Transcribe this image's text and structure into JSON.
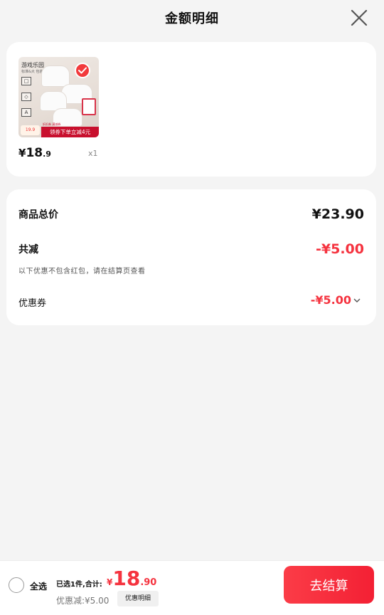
{
  "header": {
    "title": "金额明细",
    "close_icon": "close-icon"
  },
  "product": {
    "image_title": "游戏乐园",
    "image_subtitle": "标准&大 包装",
    "image_icons": [
      "□",
      "◇",
      "A"
    ],
    "image_price_tag": "19.9",
    "image_promo_top": "折扣券 满减券",
    "image_promo": "领券下单立减4元",
    "selected": true,
    "price_symbol": "¥",
    "price_int": "18",
    "price_dec": ".9",
    "qty": "x1"
  },
  "summary": {
    "total_label": "商品总价",
    "total_value": "¥23.90",
    "discount_label": "共减",
    "discount_value": "-¥5.00",
    "note": "以下优惠不包含红包，请在结算页查看",
    "coupon_label": "优惠券",
    "coupon_value": "-¥5.00"
  },
  "bottom": {
    "select_all": "全选",
    "selected_text": "已选1件,合计:",
    "price_symbol": "¥",
    "price_int": "18",
    "price_dec": ".90",
    "discount_text": "优惠减:¥5.00",
    "detail_button": "优惠明细",
    "checkout_button": "去结算"
  },
  "colors": {
    "accent": "#f5333f",
    "background": "#f4f4f4",
    "card": "#ffffff"
  }
}
